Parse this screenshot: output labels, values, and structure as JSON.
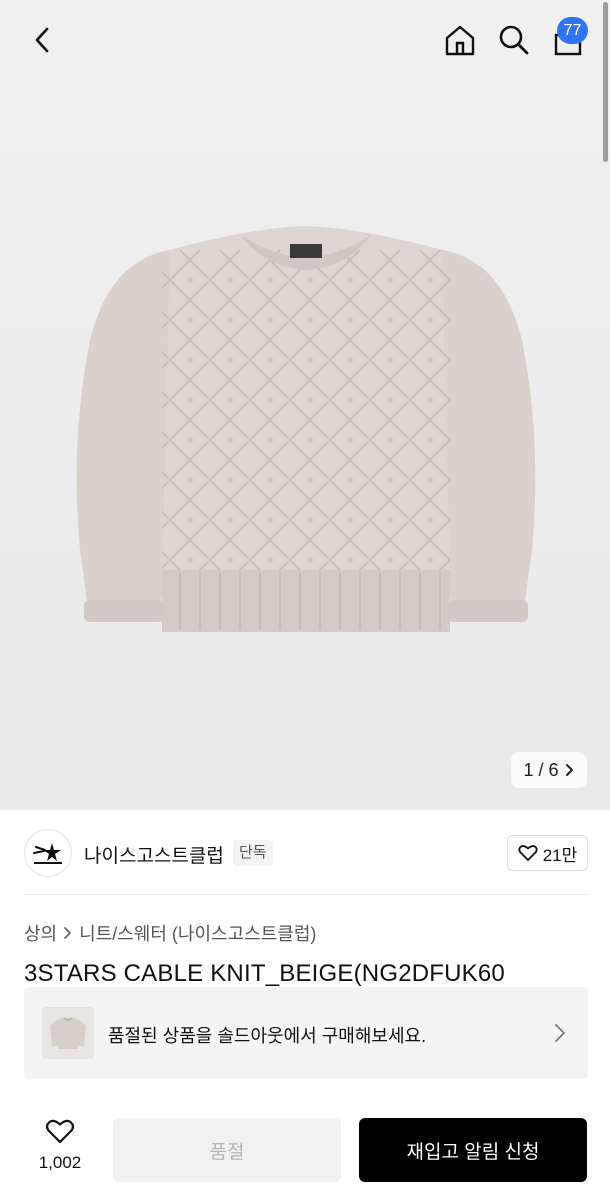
{
  "header": {
    "cart_count": "77",
    "icons": [
      "back-chevron-icon",
      "home-icon",
      "search-icon",
      "shopping-bag-icon"
    ]
  },
  "gallery": {
    "pager_text": "1 / 6"
  },
  "brand": {
    "name": "나이스고스트클럽",
    "tag": "단독",
    "likes": "21만"
  },
  "breadcrumb": {
    "category": "상의",
    "subcategory": "니트/스웨터 (나이스고스트클럽)"
  },
  "product": {
    "title": "3STARS CABLE KNIT_BEIGE(NG2DFUK60"
  },
  "banner": {
    "text": "품절된 상품을 솔드아웃에서 구매해보세요."
  },
  "bottom": {
    "wish_count": "1,002",
    "soldout_label": "품절",
    "restock_label": "재입고 알림 신청"
  },
  "colors": {
    "badge": "#2f74f0",
    "sweater": "#d8d2cb",
    "primary_button": "#000000"
  }
}
